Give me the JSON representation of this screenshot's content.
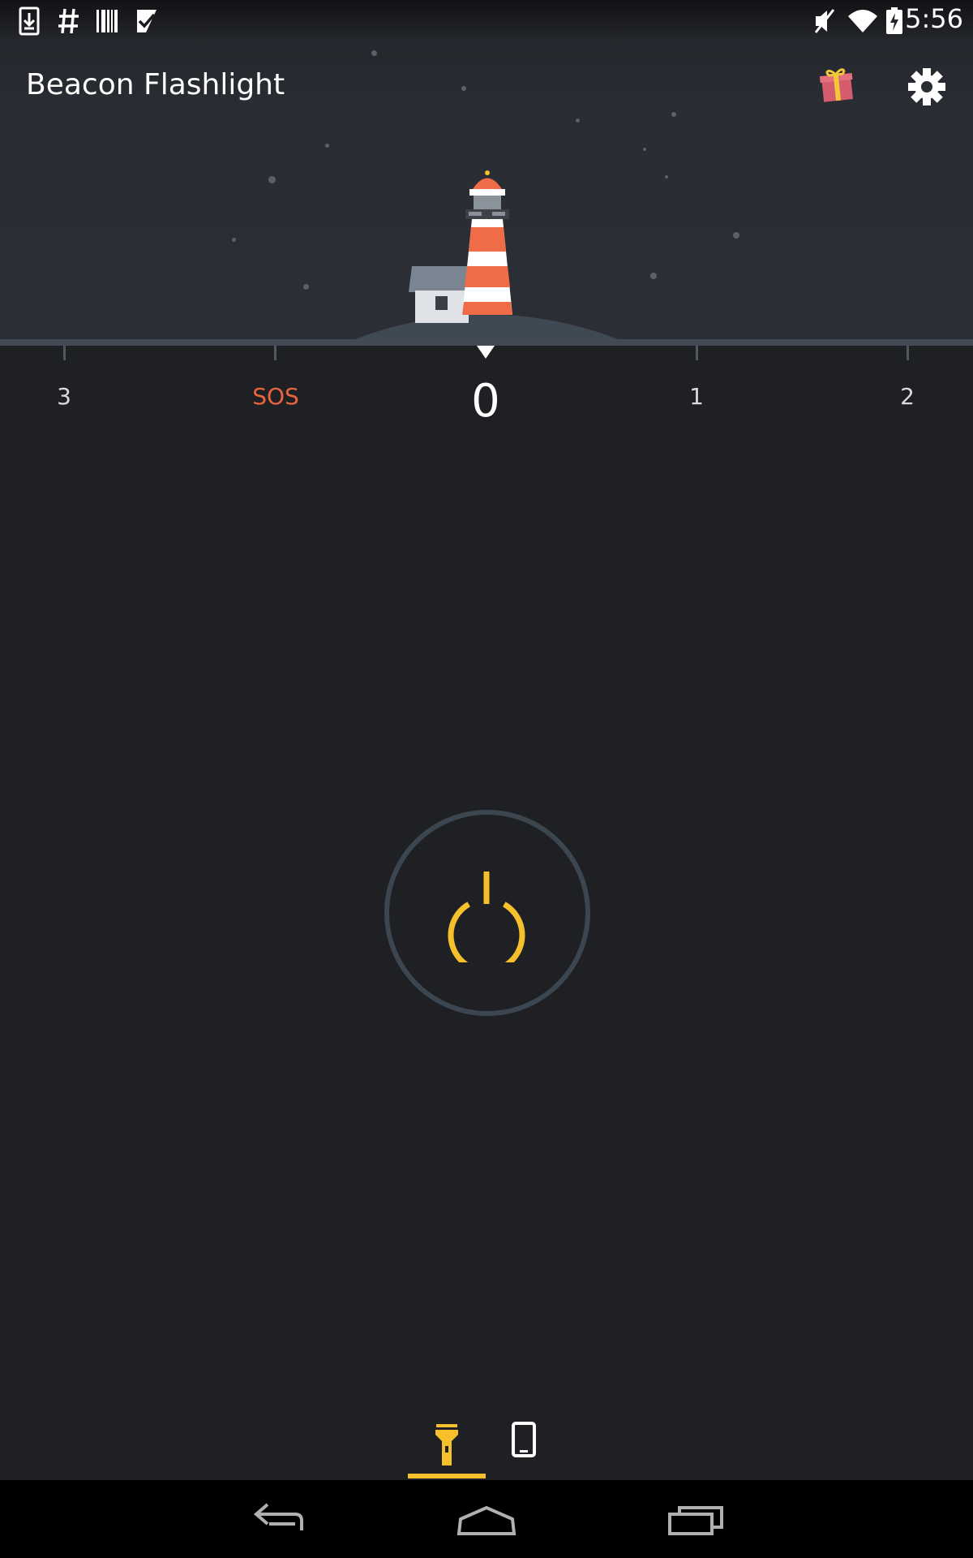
{
  "status_bar": {
    "time": "5:56",
    "left_icons": [
      "download-icon",
      "hashtag-icon",
      "barcode-icon",
      "checkmark-icon"
    ],
    "right_icons": [
      "mute-icon",
      "wifi-icon",
      "battery-charging-icon"
    ]
  },
  "app_bar": {
    "title": "Beacon Flashlight",
    "actions": [
      "gift-icon",
      "settings-icon"
    ]
  },
  "mode_selector": {
    "current": "0",
    "ticks": [
      "3",
      "SOS",
      "0",
      "1",
      "2"
    ]
  },
  "power_button": {
    "icon": "power-icon"
  },
  "bottom_tabs": [
    {
      "icon": "flashlight-icon",
      "selected": true
    },
    {
      "icon": "phone-screen-icon",
      "selected": false
    }
  ],
  "nav_bar": [
    "back-icon",
    "home-icon",
    "recents-icon"
  ],
  "colors": {
    "accent": "#f5c02b",
    "sos": "#e7653f",
    "background": "#1f2023",
    "header": "#2b2e35",
    "lighthouse_red": "#ef6c46"
  }
}
